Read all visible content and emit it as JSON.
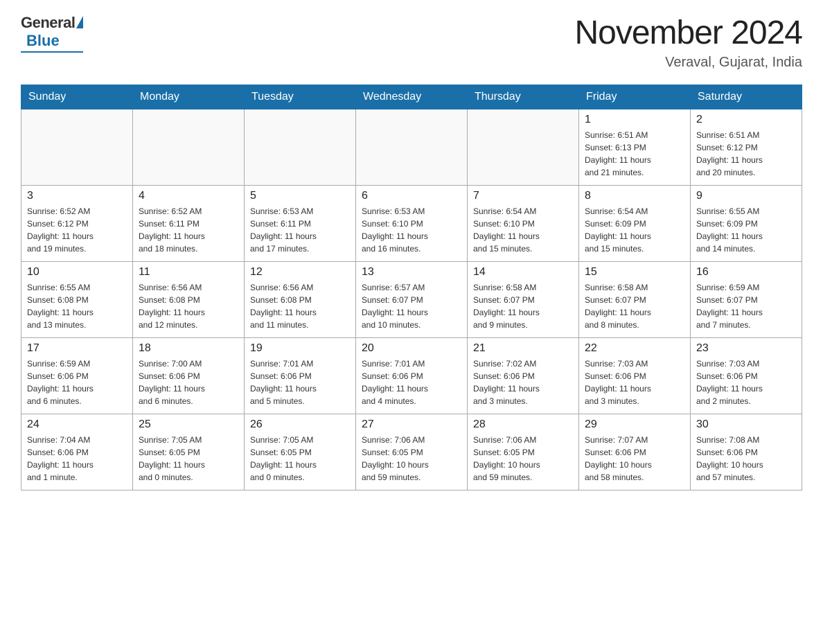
{
  "header": {
    "logo_general": "General",
    "logo_blue": "Blue",
    "title": "November 2024",
    "subtitle": "Veraval, Gujarat, India"
  },
  "calendar": {
    "days_of_week": [
      "Sunday",
      "Monday",
      "Tuesday",
      "Wednesday",
      "Thursday",
      "Friday",
      "Saturday"
    ],
    "weeks": [
      [
        {
          "day": "",
          "info": ""
        },
        {
          "day": "",
          "info": ""
        },
        {
          "day": "",
          "info": ""
        },
        {
          "day": "",
          "info": ""
        },
        {
          "day": "",
          "info": ""
        },
        {
          "day": "1",
          "info": "Sunrise: 6:51 AM\nSunset: 6:13 PM\nDaylight: 11 hours\nand 21 minutes."
        },
        {
          "day": "2",
          "info": "Sunrise: 6:51 AM\nSunset: 6:12 PM\nDaylight: 11 hours\nand 20 minutes."
        }
      ],
      [
        {
          "day": "3",
          "info": "Sunrise: 6:52 AM\nSunset: 6:12 PM\nDaylight: 11 hours\nand 19 minutes."
        },
        {
          "day": "4",
          "info": "Sunrise: 6:52 AM\nSunset: 6:11 PM\nDaylight: 11 hours\nand 18 minutes."
        },
        {
          "day": "5",
          "info": "Sunrise: 6:53 AM\nSunset: 6:11 PM\nDaylight: 11 hours\nand 17 minutes."
        },
        {
          "day": "6",
          "info": "Sunrise: 6:53 AM\nSunset: 6:10 PM\nDaylight: 11 hours\nand 16 minutes."
        },
        {
          "day": "7",
          "info": "Sunrise: 6:54 AM\nSunset: 6:10 PM\nDaylight: 11 hours\nand 15 minutes."
        },
        {
          "day": "8",
          "info": "Sunrise: 6:54 AM\nSunset: 6:09 PM\nDaylight: 11 hours\nand 15 minutes."
        },
        {
          "day": "9",
          "info": "Sunrise: 6:55 AM\nSunset: 6:09 PM\nDaylight: 11 hours\nand 14 minutes."
        }
      ],
      [
        {
          "day": "10",
          "info": "Sunrise: 6:55 AM\nSunset: 6:08 PM\nDaylight: 11 hours\nand 13 minutes."
        },
        {
          "day": "11",
          "info": "Sunrise: 6:56 AM\nSunset: 6:08 PM\nDaylight: 11 hours\nand 12 minutes."
        },
        {
          "day": "12",
          "info": "Sunrise: 6:56 AM\nSunset: 6:08 PM\nDaylight: 11 hours\nand 11 minutes."
        },
        {
          "day": "13",
          "info": "Sunrise: 6:57 AM\nSunset: 6:07 PM\nDaylight: 11 hours\nand 10 minutes."
        },
        {
          "day": "14",
          "info": "Sunrise: 6:58 AM\nSunset: 6:07 PM\nDaylight: 11 hours\nand 9 minutes."
        },
        {
          "day": "15",
          "info": "Sunrise: 6:58 AM\nSunset: 6:07 PM\nDaylight: 11 hours\nand 8 minutes."
        },
        {
          "day": "16",
          "info": "Sunrise: 6:59 AM\nSunset: 6:07 PM\nDaylight: 11 hours\nand 7 minutes."
        }
      ],
      [
        {
          "day": "17",
          "info": "Sunrise: 6:59 AM\nSunset: 6:06 PM\nDaylight: 11 hours\nand 6 minutes."
        },
        {
          "day": "18",
          "info": "Sunrise: 7:00 AM\nSunset: 6:06 PM\nDaylight: 11 hours\nand 6 minutes."
        },
        {
          "day": "19",
          "info": "Sunrise: 7:01 AM\nSunset: 6:06 PM\nDaylight: 11 hours\nand 5 minutes."
        },
        {
          "day": "20",
          "info": "Sunrise: 7:01 AM\nSunset: 6:06 PM\nDaylight: 11 hours\nand 4 minutes."
        },
        {
          "day": "21",
          "info": "Sunrise: 7:02 AM\nSunset: 6:06 PM\nDaylight: 11 hours\nand 3 minutes."
        },
        {
          "day": "22",
          "info": "Sunrise: 7:03 AM\nSunset: 6:06 PM\nDaylight: 11 hours\nand 3 minutes."
        },
        {
          "day": "23",
          "info": "Sunrise: 7:03 AM\nSunset: 6:06 PM\nDaylight: 11 hours\nand 2 minutes."
        }
      ],
      [
        {
          "day": "24",
          "info": "Sunrise: 7:04 AM\nSunset: 6:06 PM\nDaylight: 11 hours\nand 1 minute."
        },
        {
          "day": "25",
          "info": "Sunrise: 7:05 AM\nSunset: 6:05 PM\nDaylight: 11 hours\nand 0 minutes."
        },
        {
          "day": "26",
          "info": "Sunrise: 7:05 AM\nSunset: 6:05 PM\nDaylight: 11 hours\nand 0 minutes."
        },
        {
          "day": "27",
          "info": "Sunrise: 7:06 AM\nSunset: 6:05 PM\nDaylight: 10 hours\nand 59 minutes."
        },
        {
          "day": "28",
          "info": "Sunrise: 7:06 AM\nSunset: 6:05 PM\nDaylight: 10 hours\nand 59 minutes."
        },
        {
          "day": "29",
          "info": "Sunrise: 7:07 AM\nSunset: 6:06 PM\nDaylight: 10 hours\nand 58 minutes."
        },
        {
          "day": "30",
          "info": "Sunrise: 7:08 AM\nSunset: 6:06 PM\nDaylight: 10 hours\nand 57 minutes."
        }
      ]
    ]
  }
}
